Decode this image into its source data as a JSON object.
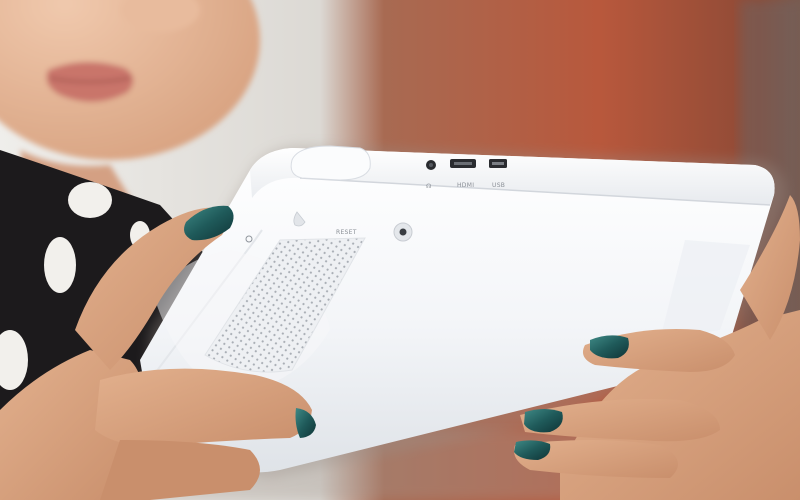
{
  "photo": {
    "ports": {
      "headphone_symbol": "☊",
      "hdmi_label": "HDMI",
      "usb_label": "USB"
    },
    "reset_label": "RESET",
    "colors": {
      "background_left": "#e8e6e3",
      "background_right": "#b5553a",
      "device_body": "#f4f5f7",
      "device_shadow": "#d6d9de",
      "skin": "#d9a47f",
      "nail_polish": "#1f5a5a",
      "shirt": "#1c1a1c",
      "shirt_dots": "#f2f0ec"
    }
  }
}
